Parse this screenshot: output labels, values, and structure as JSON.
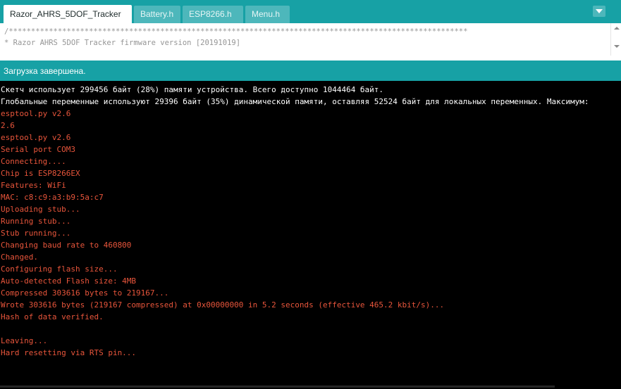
{
  "tabs": [
    {
      "label": "Razor_AHRS_5DOF_Tracker",
      "active": true
    },
    {
      "label": "Battery.h",
      "active": false
    },
    {
      "label": "ESP8266.h",
      "active": false
    },
    {
      "label": "Menu.h",
      "active": false
    }
  ],
  "editor": {
    "lines": [
      "/*******************************************************************************************************",
      "* Razor AHRS 5DOF Tracker firmware version [20191019]"
    ]
  },
  "status": {
    "message": "Загрузка завершена."
  },
  "console": {
    "lines": [
      {
        "text": "Скетч использует 299456 байт (28%) памяти устройства. Всего доступно 1044464 байт.",
        "color": "white"
      },
      {
        "text": "Глобальные переменные используют 29396 байт (35%) динамической памяти, оставляя 52524 байт для локальных переменных. Максимум:",
        "color": "white"
      },
      {
        "text": "esptool.py v2.6",
        "color": "red"
      },
      {
        "text": "2.6",
        "color": "red"
      },
      {
        "text": "esptool.py v2.6",
        "color": "red"
      },
      {
        "text": "Serial port COM3",
        "color": "red"
      },
      {
        "text": "Connecting....",
        "color": "red"
      },
      {
        "text": "Chip is ESP8266EX",
        "color": "red"
      },
      {
        "text": "Features: WiFi",
        "color": "red"
      },
      {
        "text": "MAC: c8:c9:a3:b9:5a:c7",
        "color": "red"
      },
      {
        "text": "Uploading stub...",
        "color": "red"
      },
      {
        "text": "Running stub...",
        "color": "red"
      },
      {
        "text": "Stub running...",
        "color": "red"
      },
      {
        "text": "Changing baud rate to 460800",
        "color": "red"
      },
      {
        "text": "Changed.",
        "color": "red"
      },
      {
        "text": "Configuring flash size...",
        "color": "red"
      },
      {
        "text": "Auto-detected Flash size: 4MB",
        "color": "red"
      },
      {
        "text": "Compressed 303616 bytes to 219167...",
        "color": "red"
      },
      {
        "text": "Wrote 303616 bytes (219167 compressed) at 0x00000000 in 5.2 seconds (effective 465.2 kbit/s)...",
        "color": "red"
      },
      {
        "text": "Hash of data verified.",
        "color": "red"
      },
      {
        "text": "",
        "color": "red"
      },
      {
        "text": "Leaving...",
        "color": "red"
      },
      {
        "text": "Hard resetting via RTS pin...",
        "color": "red"
      }
    ]
  },
  "colors": {
    "teal": "#17a1a5",
    "tab_inactive": "#4db7bb",
    "console_error": "#e8553b"
  },
  "icons": {
    "tab_menu": "chevron-down-icon"
  }
}
